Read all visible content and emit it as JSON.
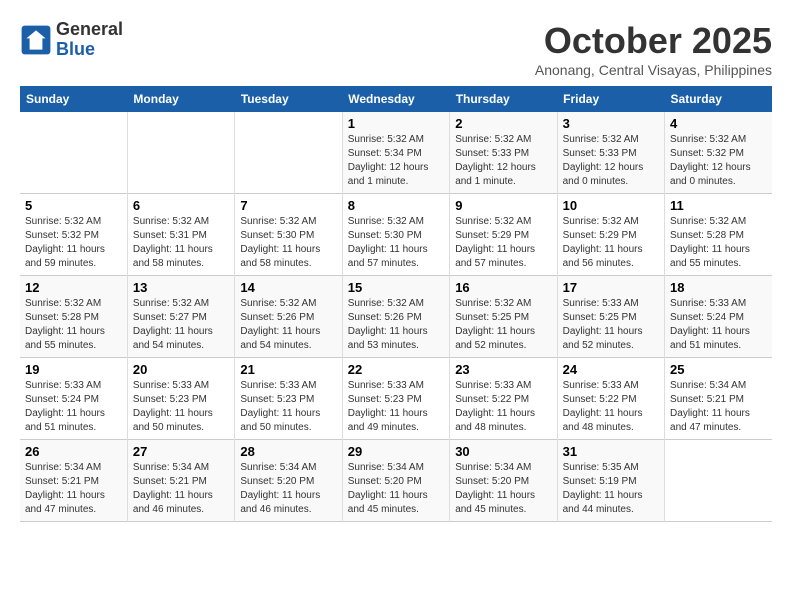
{
  "header": {
    "logo_line1": "General",
    "logo_line2": "Blue",
    "month": "October 2025",
    "location": "Anonang, Central Visayas, Philippines"
  },
  "weekdays": [
    "Sunday",
    "Monday",
    "Tuesday",
    "Wednesday",
    "Thursday",
    "Friday",
    "Saturday"
  ],
  "weeks": [
    [
      {
        "day": "",
        "info": ""
      },
      {
        "day": "",
        "info": ""
      },
      {
        "day": "",
        "info": ""
      },
      {
        "day": "1",
        "info": "Sunrise: 5:32 AM\nSunset: 5:34 PM\nDaylight: 12 hours\nand 1 minute."
      },
      {
        "day": "2",
        "info": "Sunrise: 5:32 AM\nSunset: 5:33 PM\nDaylight: 12 hours\nand 1 minute."
      },
      {
        "day": "3",
        "info": "Sunrise: 5:32 AM\nSunset: 5:33 PM\nDaylight: 12 hours\nand 0 minutes."
      },
      {
        "day": "4",
        "info": "Sunrise: 5:32 AM\nSunset: 5:32 PM\nDaylight: 12 hours\nand 0 minutes."
      }
    ],
    [
      {
        "day": "5",
        "info": "Sunrise: 5:32 AM\nSunset: 5:32 PM\nDaylight: 11 hours\nand 59 minutes."
      },
      {
        "day": "6",
        "info": "Sunrise: 5:32 AM\nSunset: 5:31 PM\nDaylight: 11 hours\nand 58 minutes."
      },
      {
        "day": "7",
        "info": "Sunrise: 5:32 AM\nSunset: 5:30 PM\nDaylight: 11 hours\nand 58 minutes."
      },
      {
        "day": "8",
        "info": "Sunrise: 5:32 AM\nSunset: 5:30 PM\nDaylight: 11 hours\nand 57 minutes."
      },
      {
        "day": "9",
        "info": "Sunrise: 5:32 AM\nSunset: 5:29 PM\nDaylight: 11 hours\nand 57 minutes."
      },
      {
        "day": "10",
        "info": "Sunrise: 5:32 AM\nSunset: 5:29 PM\nDaylight: 11 hours\nand 56 minutes."
      },
      {
        "day": "11",
        "info": "Sunrise: 5:32 AM\nSunset: 5:28 PM\nDaylight: 11 hours\nand 55 minutes."
      }
    ],
    [
      {
        "day": "12",
        "info": "Sunrise: 5:32 AM\nSunset: 5:28 PM\nDaylight: 11 hours\nand 55 minutes."
      },
      {
        "day": "13",
        "info": "Sunrise: 5:32 AM\nSunset: 5:27 PM\nDaylight: 11 hours\nand 54 minutes."
      },
      {
        "day": "14",
        "info": "Sunrise: 5:32 AM\nSunset: 5:26 PM\nDaylight: 11 hours\nand 54 minutes."
      },
      {
        "day": "15",
        "info": "Sunrise: 5:32 AM\nSunset: 5:26 PM\nDaylight: 11 hours\nand 53 minutes."
      },
      {
        "day": "16",
        "info": "Sunrise: 5:32 AM\nSunset: 5:25 PM\nDaylight: 11 hours\nand 52 minutes."
      },
      {
        "day": "17",
        "info": "Sunrise: 5:33 AM\nSunset: 5:25 PM\nDaylight: 11 hours\nand 52 minutes."
      },
      {
        "day": "18",
        "info": "Sunrise: 5:33 AM\nSunset: 5:24 PM\nDaylight: 11 hours\nand 51 minutes."
      }
    ],
    [
      {
        "day": "19",
        "info": "Sunrise: 5:33 AM\nSunset: 5:24 PM\nDaylight: 11 hours\nand 51 minutes."
      },
      {
        "day": "20",
        "info": "Sunrise: 5:33 AM\nSunset: 5:23 PM\nDaylight: 11 hours\nand 50 minutes."
      },
      {
        "day": "21",
        "info": "Sunrise: 5:33 AM\nSunset: 5:23 PM\nDaylight: 11 hours\nand 50 minutes."
      },
      {
        "day": "22",
        "info": "Sunrise: 5:33 AM\nSunset: 5:23 PM\nDaylight: 11 hours\nand 49 minutes."
      },
      {
        "day": "23",
        "info": "Sunrise: 5:33 AM\nSunset: 5:22 PM\nDaylight: 11 hours\nand 48 minutes."
      },
      {
        "day": "24",
        "info": "Sunrise: 5:33 AM\nSunset: 5:22 PM\nDaylight: 11 hours\nand 48 minutes."
      },
      {
        "day": "25",
        "info": "Sunrise: 5:34 AM\nSunset: 5:21 PM\nDaylight: 11 hours\nand 47 minutes."
      }
    ],
    [
      {
        "day": "26",
        "info": "Sunrise: 5:34 AM\nSunset: 5:21 PM\nDaylight: 11 hours\nand 47 minutes."
      },
      {
        "day": "27",
        "info": "Sunrise: 5:34 AM\nSunset: 5:21 PM\nDaylight: 11 hours\nand 46 minutes."
      },
      {
        "day": "28",
        "info": "Sunrise: 5:34 AM\nSunset: 5:20 PM\nDaylight: 11 hours\nand 46 minutes."
      },
      {
        "day": "29",
        "info": "Sunrise: 5:34 AM\nSunset: 5:20 PM\nDaylight: 11 hours\nand 45 minutes."
      },
      {
        "day": "30",
        "info": "Sunrise: 5:34 AM\nSunset: 5:20 PM\nDaylight: 11 hours\nand 45 minutes."
      },
      {
        "day": "31",
        "info": "Sunrise: 5:35 AM\nSunset: 5:19 PM\nDaylight: 11 hours\nand 44 minutes."
      },
      {
        "day": "",
        "info": ""
      }
    ]
  ]
}
